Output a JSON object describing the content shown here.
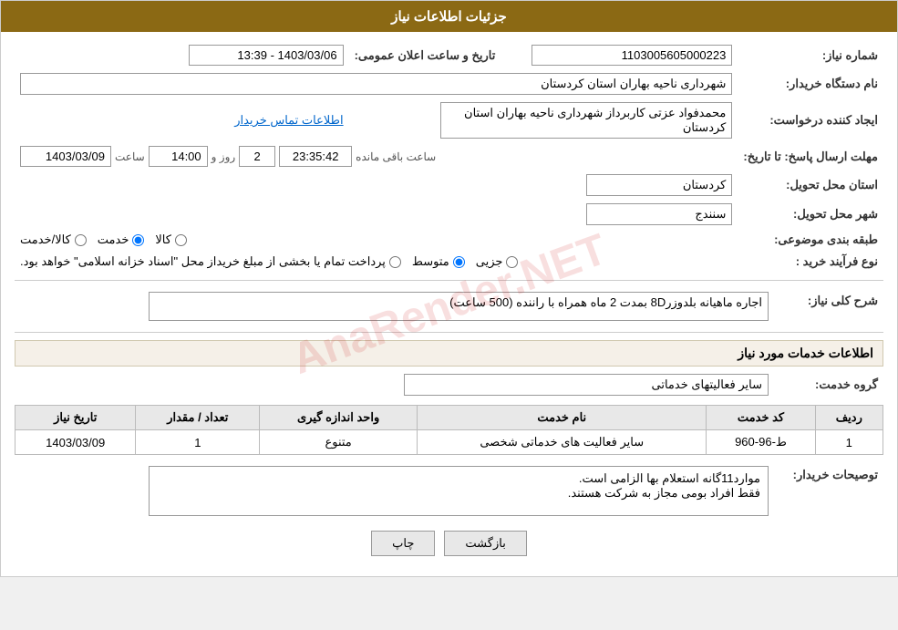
{
  "page": {
    "title": "جزئیات اطلاعات نیاز"
  },
  "fields": {
    "need_number_label": "شماره نیاز:",
    "need_number_value": "1103005605000223",
    "buyer_org_label": "نام دستگاه خریدار:",
    "buyer_org_value": "شهرداری ناحیه بهاران استان کردستان",
    "creator_label": "ایجاد کننده درخواست:",
    "creator_value": "محمدفواد عزتی کاربرداز شهرداری ناحیه بهاران استان کردستان",
    "contact_link": "اطلاعات تماس خریدار",
    "deadline_label": "مهلت ارسال پاسخ: تا تاریخ:",
    "deadline_date": "1403/03/09",
    "deadline_time_label": "ساعت",
    "deadline_time": "14:00",
    "deadline_day_label": "روز و",
    "deadline_days": "2",
    "deadline_remaining_label": "ساعت باقی مانده",
    "deadline_remaining_time": "23:35:42",
    "province_label": "استان محل تحویل:",
    "province_value": "کردستان",
    "city_label": "شهر محل تحویل:",
    "city_value": "سنندج",
    "category_label": "طبقه بندی موضوعی:",
    "category_options": [
      {
        "id": "kala",
        "label": "کالا"
      },
      {
        "id": "khadamat",
        "label": "خدمت"
      },
      {
        "id": "kala_khadamat",
        "label": "کالا/خدمت"
      }
    ],
    "category_selected": "khadamat",
    "purchase_type_label": "نوع فرآیند خرید :",
    "purchase_type_options": [
      {
        "id": "jozi",
        "label": "جزیی"
      },
      {
        "id": "mottaset",
        "label": "متوسط"
      },
      {
        "id": "other",
        "label": "پرداخت تمام یا بخشی از مبلغ خریداز محل \"اسناد خزانه اسلامی\" خواهد بود."
      }
    ],
    "purchase_type_selected": "mottaset",
    "announcement_label": "تاریخ و ساعت اعلان عمومی:",
    "announcement_value": "1403/03/06 - 13:39"
  },
  "need_description": {
    "label": "شرح کلی نیاز:",
    "value": "اجاره ماهیانه بلدوزر8D بمدت 2 ماه همراه با راننده (500 ساعت)"
  },
  "services_section": {
    "title": "اطلاعات خدمات مورد نیاز",
    "service_group_label": "گروه خدمت:",
    "service_group_value": "سایر فعالیتهای خدماتی",
    "table_headers": [
      "ردیف",
      "کد خدمت",
      "نام خدمت",
      "واحد اندازه گیری",
      "تعداد / مقدار",
      "تاریخ نیاز"
    ],
    "table_rows": [
      {
        "row_num": "1",
        "service_code": "ط-96-960",
        "service_name": "سایر فعالیت های خدماتی شخصی",
        "unit": "متنوع",
        "quantity": "1",
        "date": "1403/03/09"
      }
    ]
  },
  "buyer_description": {
    "label": "توصیحات خریدار:",
    "value": "موارد11گانه استعلام بها الزامی است.\nفقط افراد بومی مجاز به شرکت هستند."
  },
  "buttons": {
    "print_label": "چاپ",
    "back_label": "بازگشت"
  }
}
